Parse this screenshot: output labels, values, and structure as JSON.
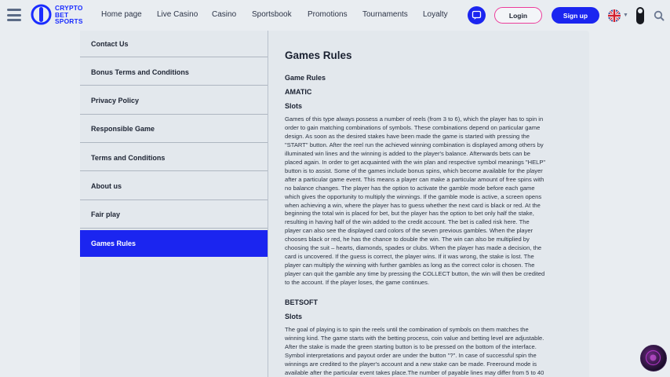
{
  "brand": {
    "logo_lines": [
      "CRYPTO",
      "BET",
      "SPORTS"
    ],
    "accent": "#1b25f0",
    "login_border": "#ec3d9b"
  },
  "nav": {
    "items": [
      {
        "label": "Home page",
        "width": 71
      },
      {
        "label": "Live Casino",
        "width": 70
      },
      {
        "label": "Casino",
        "width": 51
      },
      {
        "label": "Sportsbook",
        "width": 71
      },
      {
        "label": "Promotions",
        "width": 70
      },
      {
        "label": "Tournaments",
        "width": 77
      },
      {
        "label": "Loyalty",
        "width": 45
      }
    ]
  },
  "header": {
    "chat_icon": "chat-bubble-icon",
    "login_label": "Login",
    "signup_label": "Sign up",
    "language_icon": "uk-flag-icon",
    "theme_icon": "theme-toggle-icon",
    "search_icon": "search-icon"
  },
  "sidebar": {
    "items": [
      {
        "label": "Contact Us",
        "active": false
      },
      {
        "label": "Bonus Terms and Conditions",
        "active": false
      },
      {
        "label": "Privacy Policy",
        "active": false
      },
      {
        "label": "Responsible Game",
        "active": false
      },
      {
        "label": "Terms and Conditions",
        "active": false
      },
      {
        "label": "About us",
        "active": false
      },
      {
        "label": "Fair play",
        "active": false
      },
      {
        "label": "Games Rules",
        "active": true
      }
    ]
  },
  "content": {
    "title": "Games Rules",
    "subtitle": "Game Rules",
    "section1_heading": "AMATIC",
    "section1_sub": "Slots",
    "section1_lines": [
      "Games of this type always possess a number of reels (from 3 to 6), which the player has to spin in",
      "order to gain matching combinations of symbols. These combinations depend on particular game",
      "design. As soon as the desired stakes have been made the game is started with pressing the",
      "\"START\" button. After the reel run the achieved winning combination is displayed among others by",
      "illuminated win lines and the winning is added to the player's balance. Afterwards bets can be",
      "placed again. In order to get acquainted with the win plan and respective symbol meanings \"HELP\"",
      "button is to assist. Some of the games include bonus spins, which become available for the player",
      "after a particular game event. This means a player can make a particular amount of free spins with",
      "no balance changes. The player has the option to activate the gamble mode before each game",
      "which gives the opportunity to multiply the winnings. If the gamble mode is active, a screen opens",
      "when achieving a win, where the player has to guess whether the next card is black or red. At the",
      "beginning the total win is placed for bet, but the player has the option to bet only half the stake,",
      "resulting in having half of the win added to the credit account. The bet is called risk here. The",
      "player can also see the displayed card colors of the seven previous gambles. When the player",
      "chooses black or red, he has the chance to double the win. The win can also be multiplied by",
      "choosing the suit – hearts, diamonds, spades or clubs. When the player has made a decision, the",
      "card is uncovered. If the guess is correct, the player wins. If it was wrong, the stake is lost. The",
      "player can multiply the winning with further gambles as long as the correct color is chosen. The",
      "player can quit the gamble any time by pressing the COLLECT button, the win will then be credited",
      "to the account. If the player loses, the game continues."
    ],
    "section2_heading": "BETSOFT",
    "section2_sub": "Slots",
    "section2_lines": [
      "The goal of playing is to spin the reels until the combination of symbols on them matches the",
      "winning kind. The game starts with the betting process, coin value and betting level are adjustable.",
      "After the stake is made the green starting button is to be pressed on the bottom of the interface.",
      "Symbol interpretations and payout order are under the button \"?\". In case of successful spin the",
      "winnings are credited to the player's account and a new stake can be made. Freeround mode is",
      "available after the particular event takes place.The number of payable lines may differ from 5 to 40"
    ]
  },
  "floating": {
    "icon": "promo-orb-icon"
  }
}
